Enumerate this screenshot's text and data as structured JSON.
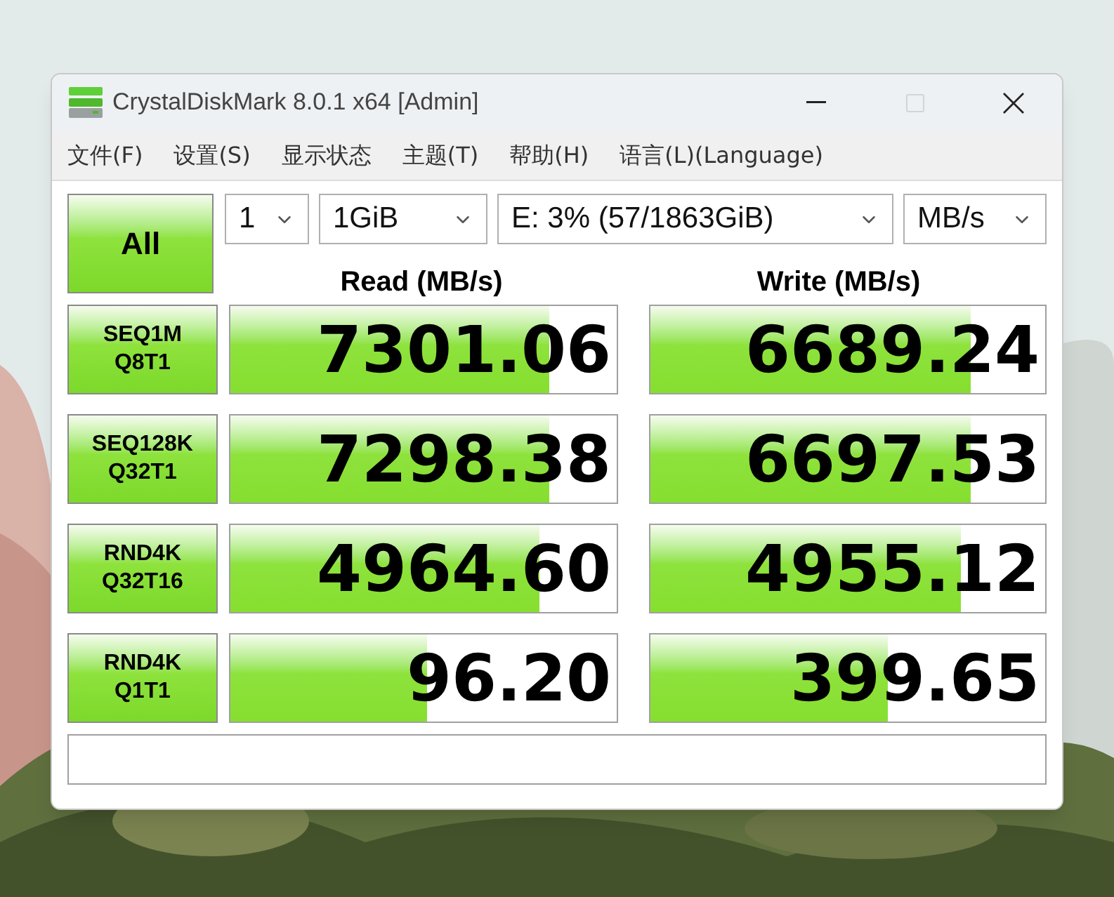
{
  "window": {
    "title": "CrystalDiskMark 8.0.1 x64 [Admin]",
    "controls": [
      {
        "kind": "minimize",
        "disabled": false
      },
      {
        "kind": "maximize",
        "disabled": true
      },
      {
        "kind": "close",
        "disabled": false
      }
    ]
  },
  "menu": [
    "文件(F)",
    "设置(S)",
    "显示状态",
    "主题(T)",
    "帮助(H)",
    "语言(L)(Language)"
  ],
  "all_button": "All",
  "selects": [
    {
      "kind": "count",
      "value": "1"
    },
    {
      "kind": "size",
      "value": "1GiB"
    },
    {
      "kind": "drive",
      "value": "E: 3% (57/1863GiB)"
    },
    {
      "kind": "unit",
      "value": "MB/s"
    }
  ],
  "headers": {
    "read": "Read (MB/s)",
    "write": "Write (MB/s)"
  },
  "tests": [
    {
      "name": "SEQ1M",
      "params": "Q8T1",
      "read": {
        "value": "7301.06",
        "level": 0.825
      },
      "write": {
        "value": "6689.24",
        "level": 0.81
      }
    },
    {
      "name": "SEQ128K",
      "params": "Q32T1",
      "read": {
        "value": "7298.38",
        "level": 0.825
      },
      "write": {
        "value": "6697.53",
        "level": 0.81
      }
    },
    {
      "name": "RND4K",
      "params": "Q32T16",
      "read": {
        "value": "4964.60",
        "level": 0.8
      },
      "write": {
        "value": "4955.12",
        "level": 0.785
      }
    },
    {
      "name": "RND4K",
      "params": "Q1T1",
      "read": {
        "value": "96.20",
        "level": 0.51
      },
      "write": {
        "value": "399.65",
        "level": 0.6
      }
    }
  ]
}
